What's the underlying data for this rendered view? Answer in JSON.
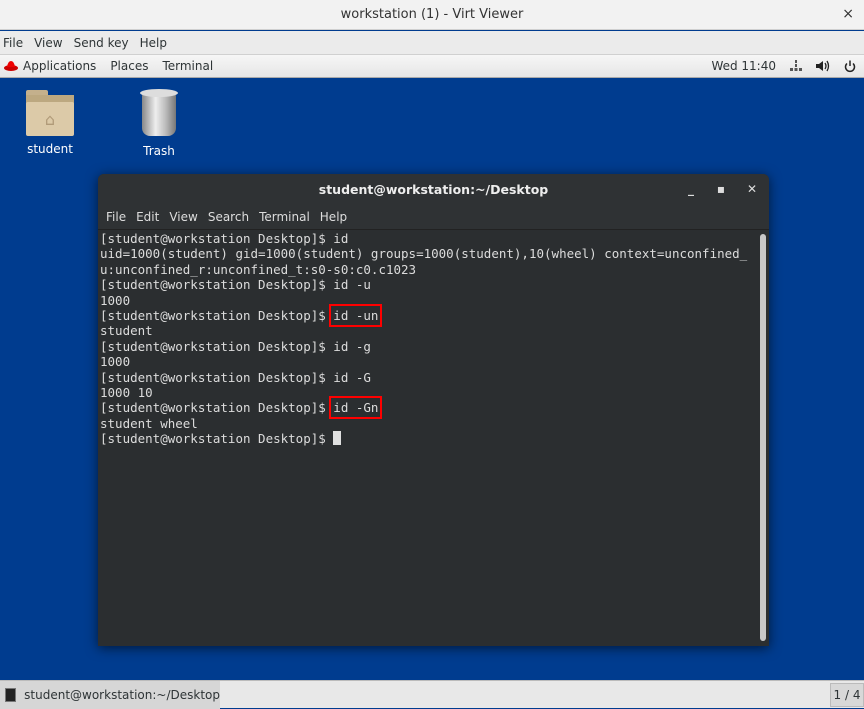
{
  "window": {
    "title": "workstation (1) - Virt Viewer",
    "close": "×"
  },
  "menubar": [
    "File",
    "View",
    "Send key",
    "Help"
  ],
  "panel": {
    "applications": "Applications",
    "places": "Places",
    "terminal": "Terminal",
    "clock": "Wed 11:40",
    "icons": [
      "network-icon",
      "volume-icon",
      "power-icon"
    ]
  },
  "desktop": {
    "icons": [
      {
        "label": "student",
        "icon": "home-folder-icon"
      },
      {
        "label": "Trash",
        "icon": "trash-icon"
      }
    ]
  },
  "terminal": {
    "title": "student@workstation:~/Desktop",
    "menu": [
      "File",
      "Edit",
      "View",
      "Search",
      "Terminal",
      "Help"
    ],
    "prompt": "[student@workstation Desktop]$ ",
    "lines": [
      {
        "prompt": true,
        "text": "id"
      },
      {
        "text": "uid=1000(student) gid=1000(student) groups=1000(student),10(wheel) context=unconfined_"
      },
      {
        "text": "u:unconfined_r:unconfined_t:s0-s0:c0.c1023"
      },
      {
        "prompt": true,
        "text": "id -u"
      },
      {
        "text": "1000"
      },
      {
        "prompt": true,
        "text": "id -un",
        "highlight": true
      },
      {
        "text": "student"
      },
      {
        "prompt": true,
        "text": "id -g"
      },
      {
        "text": "1000"
      },
      {
        "prompt": true,
        "text": "id -G"
      },
      {
        "text": "1000 10"
      },
      {
        "prompt": true,
        "text": "id -Gn",
        "highlight": true
      },
      {
        "text": "student wheel"
      },
      {
        "prompt": true,
        "text": "",
        "cursor": true
      }
    ],
    "highlight_color": "#ff0000"
  },
  "taskbar": {
    "task": "student@workstation:~/Desktop",
    "workspace": "1 / 4"
  }
}
